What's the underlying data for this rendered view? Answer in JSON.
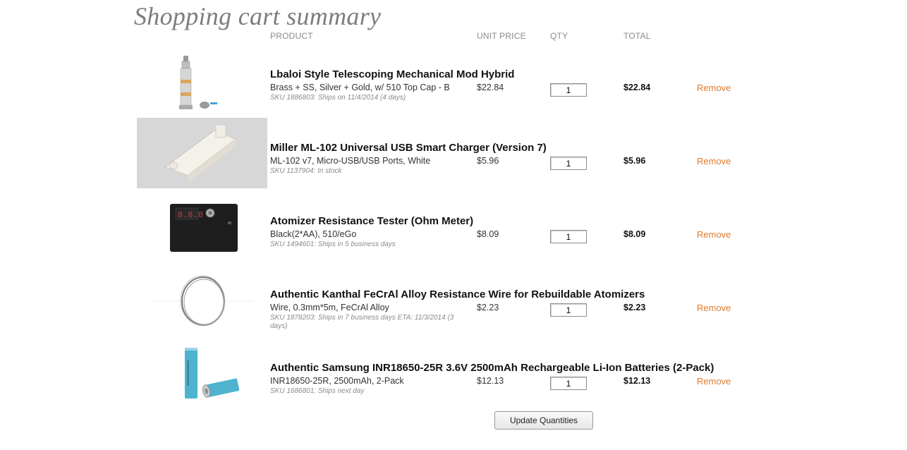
{
  "page": {
    "title": "Shopping cart summary"
  },
  "columns": {
    "product": "PRODUCT",
    "unit_price": "UNIT PRICE",
    "qty": "QTY",
    "total": "TOTAL"
  },
  "items": [
    {
      "name": "Lbaloi Style Telescoping Mechanical Mod Hybrid",
      "variant": "Brass + SS, Silver + Gold, w/ 510 Top Cap - B",
      "sku": "SKU 1886803: Ships on 11/4/2014 (4 days)",
      "unit_price": "$22.84",
      "qty": "1",
      "total": "$22.84",
      "remove": "Remove",
      "image_icon": "mechanical-mod-image"
    },
    {
      "name": "Miller ML-102 Universal USB Smart Charger (Version 7)",
      "variant": "ML-102 v7, Micro-USB/USB Ports, White",
      "sku": "SKU 1137904: In stock",
      "unit_price": "$5.96",
      "qty": "1",
      "total": "$5.96",
      "remove": "Remove",
      "image_icon": "usb-charger-image"
    },
    {
      "name": "Atomizer Resistance Tester (Ohm Meter)",
      "variant": "Black(2*AA), 510/eGo",
      "sku": "SKU 1494601: Ships in 5 business days",
      "unit_price": "$8.09",
      "qty": "1",
      "total": "$8.09",
      "remove": "Remove",
      "image_icon": "ohm-meter-image"
    },
    {
      "name": "Authentic Kanthal FeCrAl Alloy Resistance Wire for Rebuildable Atomizers",
      "variant": "Wire, 0.3mm*5m, FeCrAl Alloy",
      "sku": "SKU 1878203: Ships in 7 business days ETA: 11/3/2014 (3 days)",
      "unit_price": "$2.23",
      "qty": "1",
      "total": "$2.23",
      "remove": "Remove",
      "image_icon": "wire-coil-image"
    },
    {
      "name": "Authentic Samsung INR18650-25R 3.6V 2500mAh Rechargeable Li-Ion Batteries (2-Pack)",
      "variant": "INR18650-25R, 2500mAh, 2-Pack",
      "sku": "SKU 1686801: Ships next day",
      "unit_price": "$12.13",
      "qty": "1",
      "total": "$12.13",
      "remove": "Remove",
      "image_icon": "battery-image"
    }
  ],
  "actions": {
    "update_quantities": "Update Quantities"
  },
  "colors": {
    "accent": "#e07a2e",
    "title": "#7d7d7d",
    "muted": "#8a8a8a"
  }
}
